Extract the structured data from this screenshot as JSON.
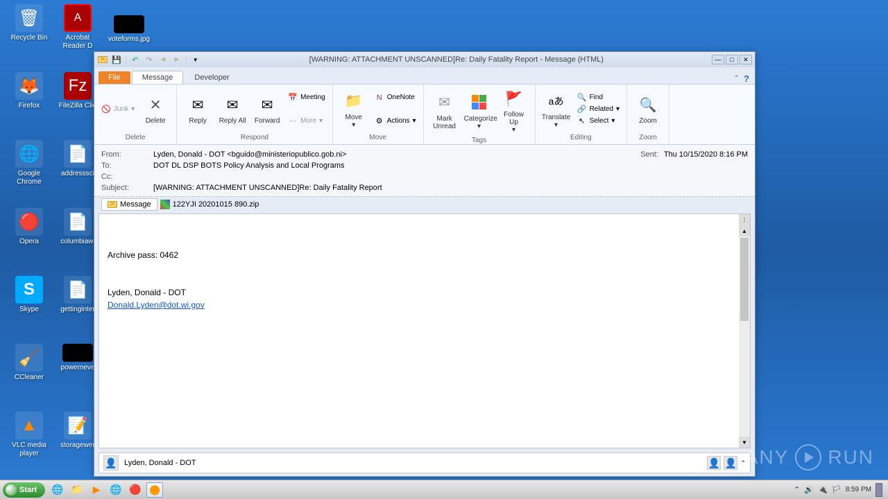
{
  "desktop": {
    "icons": [
      {
        "label": "Recycle Bin",
        "glyph": "🗑"
      },
      {
        "label": "Acrobat Reader D",
        "glyph": "📕"
      },
      {
        "label": "voteforms.jpg",
        "glyph": "🖼"
      },
      {
        "label": "Firefox",
        "glyph": "🦊"
      },
      {
        "label": "FileZilla Clie",
        "glyph": "📁"
      },
      {
        "label": "Google Chrome",
        "glyph": "🌐"
      },
      {
        "label": "addresssci",
        "glyph": "📄"
      },
      {
        "label": "Opera",
        "glyph": "🔴"
      },
      {
        "label": "columbiawi",
        "glyph": "📄"
      },
      {
        "label": "Skype",
        "glyph": "💬"
      },
      {
        "label": "gettinginter",
        "glyph": "📄"
      },
      {
        "label": "CCleaner",
        "glyph": "🧹"
      },
      {
        "label": "powerneve",
        "glyph": "⬛"
      },
      {
        "label": "VLC media player",
        "glyph": "▶"
      },
      {
        "label": "storagewer",
        "glyph": "📝"
      }
    ]
  },
  "window": {
    "title": "[WARNING: ATTACHMENT UNSCANNED]Re: Daily Fatality Report  -  Message (HTML)"
  },
  "tabs": {
    "file": "File",
    "message": "Message",
    "developer": "Developer"
  },
  "ribbon": {
    "delete": {
      "junk": "Junk",
      "delete": "Delete",
      "group": "Delete"
    },
    "respond": {
      "reply": "Reply",
      "replyall": "Reply All",
      "forward": "Forward",
      "meeting": "Meeting",
      "more": "More",
      "group": "Respond"
    },
    "move": {
      "move": "Move",
      "onenote": "OneNote",
      "actions": "Actions",
      "group": "Move"
    },
    "tags": {
      "markunread": "Mark Unread",
      "categorize": "Categorize",
      "followup": "Follow Up",
      "group": "Tags"
    },
    "editing": {
      "translate": "Translate",
      "find": "Find",
      "related": "Related",
      "select": "Select",
      "group": "Editing"
    },
    "zoom": {
      "zoom": "Zoom",
      "group": "Zoom"
    }
  },
  "headers": {
    "from_label": "From:",
    "from_value": "Lyden, Donald - DOT <bguido@ministeriopublico.gob.ni>",
    "sent_label": "Sent:",
    "sent_value": "Thu 10/15/2020 8:16 PM",
    "to_label": "To:",
    "to_value": "DOT DL DSP BOTS Policy Analysis and Local Programs",
    "cc_label": "Cc:",
    "cc_value": "",
    "subject_label": "Subject:",
    "subject_value": "[WARNING: ATTACHMENT UNSCANNED]Re: Daily Fatality Report"
  },
  "attachment": {
    "message_tab": "Message",
    "filename": "122YJI 20201015 890.zip"
  },
  "body": {
    "line1": "Archive pass: 0462",
    "signature": "Lyden, Donald - DOT",
    "email": "Donald.Lyden@dot.wi.gov"
  },
  "people": {
    "name": "Lyden, Donald - DOT"
  },
  "taskbar": {
    "start": "Start",
    "time": "8:59 PM"
  },
  "watermark": {
    "text1": "ANY",
    "text2": "RUN"
  }
}
